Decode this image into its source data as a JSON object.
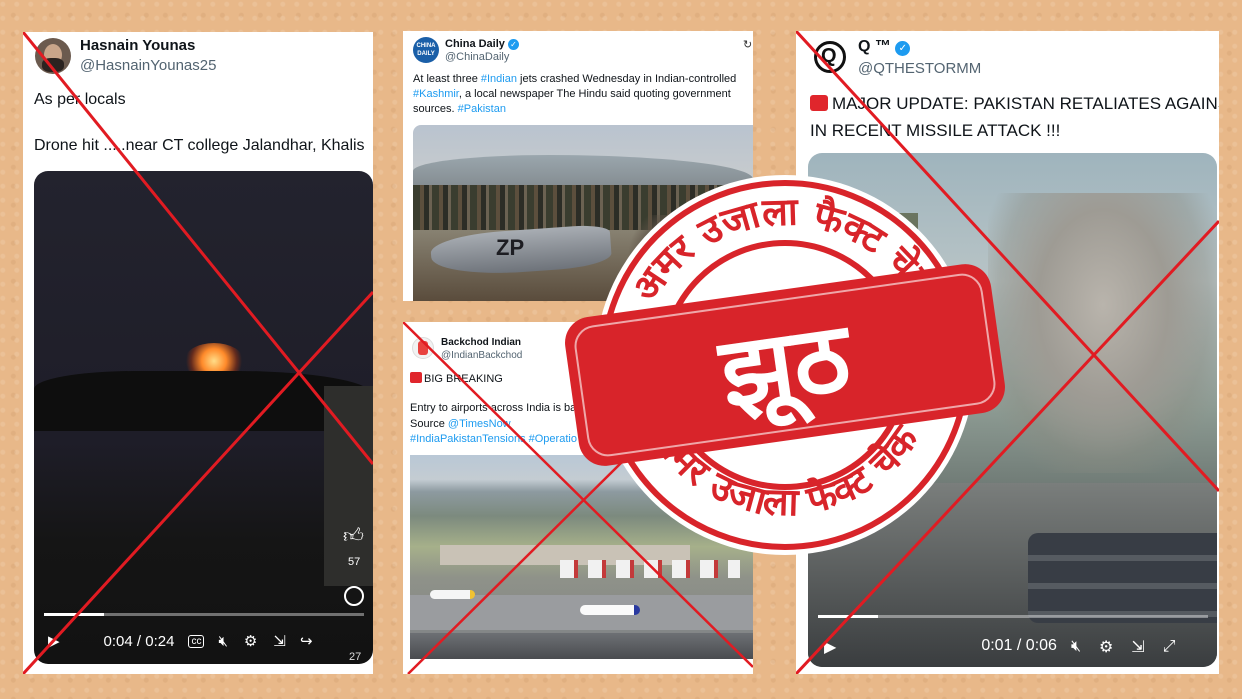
{
  "card1": {
    "name": "Hasnain Younas",
    "handle": "@HasnainYounas25",
    "line1": "As per locals",
    "line2": "Drone hit .....near CT college Jalandhar, Khalis",
    "time": "0:04 / 0:24",
    "like_count": "57",
    "share_count": "27",
    "cc": "cc"
  },
  "card2": {
    "name": "China Daily",
    "handle": "@ChinaDaily",
    "avatar_text": "CHINA DAILY",
    "text_a": "At least three ",
    "tag_indian": "#Indian",
    "text_b": " jets crashed Wednesday in Indian-controlled ",
    "tag_kashmir": "#Kashmir",
    "text_c": ", a local newspaper The Hindu said quoting government sources. ",
    "tag_pakistan": "#Pakistan",
    "jet_marking": "ZP"
  },
  "card3": {
    "name": "Backchod Indian",
    "handle": "@IndianBackchod",
    "headline": "BIG BREAKING",
    "line1": "Entry to airports across India is ba",
    "source_label": "Source ",
    "source_link": "@TimesNow",
    "tags": "#IndiaPakistanTensions #Operatio"
  },
  "card4": {
    "name": "Q ™",
    "handle": "@QTHESTORMM",
    "avatar_letter": "Q",
    "update_line1": "MAJOR UPDATE: PAKISTAN RETALIATES AGAINS",
    "update_line2": "IN RECENT MISSILE ATTACK !!!",
    "time": "0:01 / 0:06"
  },
  "stamp": {
    "top_text": "अमर उजाला फैक्ट चेक",
    "bottom_text": "अमर उजाला फैक्ट चेक",
    "verdict": "झूठ"
  },
  "colors": {
    "background": "#e8b889",
    "stamp_red": "#d8242a",
    "cross_red": "#e11b22",
    "link_blue": "#1d9bf0"
  }
}
